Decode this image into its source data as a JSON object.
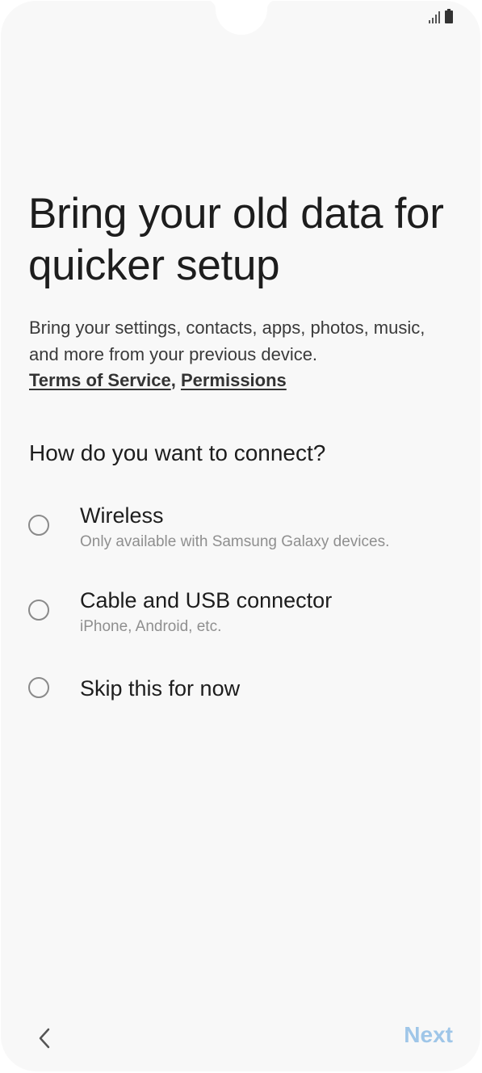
{
  "screen": {
    "title": "Bring your old data for quicker setup",
    "description": "Bring your settings, contacts, apps, photos, music, and more from your previous device.",
    "links": {
      "terms": "Terms of Service",
      "separator": ",",
      "permissions": "Permissions"
    },
    "question": "How do you want to connect?"
  },
  "options": [
    {
      "label": "Wireless",
      "sublabel": "Only available with Samsung Galaxy devices.",
      "selected": false
    },
    {
      "label": "Cable and USB connector",
      "sublabel": "iPhone, Android, etc.",
      "selected": false
    },
    {
      "label": "Skip this for now",
      "sublabel": "",
      "selected": false
    }
  ],
  "navigation": {
    "back_icon": "chevron-left-icon",
    "next_label": "Next",
    "next_enabled": false
  },
  "status_bar": {
    "icons": [
      "signal-icon",
      "battery-icon"
    ]
  },
  "colors": {
    "background": "#f8f8f8",
    "next_disabled": "#9fc6e8",
    "radio_border": "#8a8a8a"
  }
}
